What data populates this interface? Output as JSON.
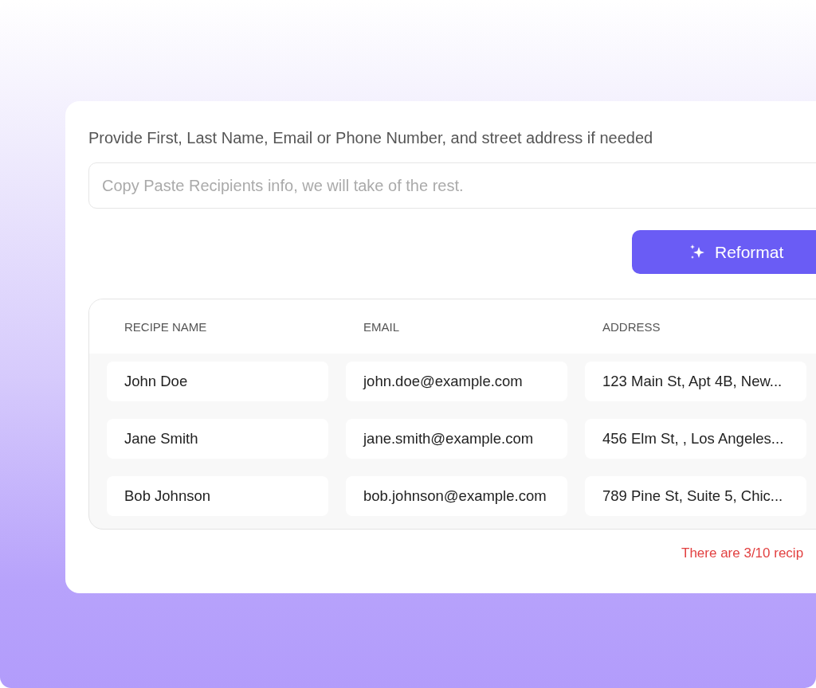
{
  "form": {
    "instruction": "Provide First, Last Name, Email or Phone Number, and street address if needed",
    "input": {
      "placeholder": "Copy Paste Recipients info, we will take of the rest."
    },
    "button": {
      "label": "Reformat"
    }
  },
  "table": {
    "columns": [
      "RECIPE NAME",
      "EMAIL",
      "ADDRESS"
    ],
    "rows": [
      [
        "John Doe",
        "john.doe@example.com",
        "123 Main St, Apt 4B, New..."
      ],
      [
        "Jane Smith",
        "jane.smith@example.com",
        "456 Elm St, , Los Angeles..."
      ],
      [
        "Bob Johnson",
        "bob.johnson@example.com",
        "789 Pine St, Suite 5, Chic..."
      ]
    ]
  },
  "footer": {
    "message": "There are 3/10 recip"
  }
}
